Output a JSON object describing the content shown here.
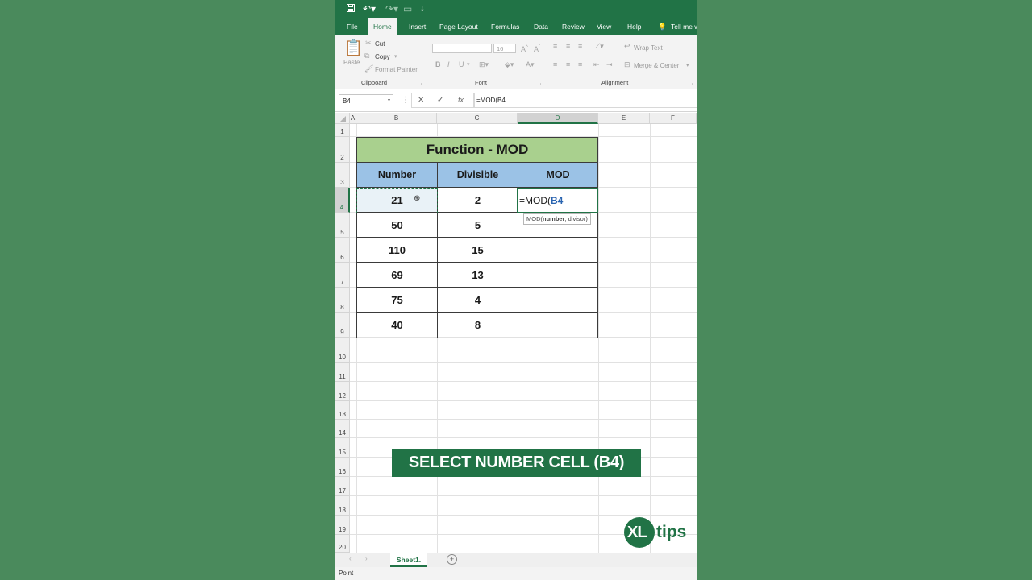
{
  "qat": {
    "save_icon": "save-icon",
    "undo_icon": "undo-icon",
    "redo_icon": "redo-icon",
    "customize_icon": "customize-icon"
  },
  "tabs": [
    "File",
    "Home",
    "Insert",
    "Page Layout",
    "Formulas",
    "Data",
    "Review",
    "View",
    "Help"
  ],
  "tell_me": "Tell me w",
  "ribbon": {
    "clipboard": {
      "paste": "Paste",
      "cut": "Cut",
      "copy": "Copy",
      "format_painter": "Format Painter",
      "label": "Clipboard"
    },
    "font": {
      "size": "16",
      "label": "Font"
    },
    "alignment": {
      "wrap_text": "Wrap Text",
      "merge_center": "Merge & Center",
      "label": "Alignment"
    }
  },
  "formula_bar": {
    "name_box": "B4",
    "formula": "=MOD(B4"
  },
  "columns": [
    "A",
    "B",
    "C",
    "D",
    "E",
    "F"
  ],
  "rows": [
    "1",
    "2",
    "3",
    "4",
    "5",
    "6",
    "7",
    "8",
    "9",
    "10",
    "11",
    "12",
    "13",
    "14",
    "15",
    "16",
    "17",
    "18",
    "19",
    "20"
  ],
  "table": {
    "title": "Function - MOD",
    "headers": [
      "Number",
      "Divisible",
      "MOD"
    ],
    "rows": [
      [
        "21",
        "2"
      ],
      [
        "50",
        "5"
      ],
      [
        "110",
        "15"
      ],
      [
        "69",
        "13"
      ],
      [
        "75",
        "4"
      ],
      [
        "40",
        "8"
      ]
    ]
  },
  "editing": {
    "prefix": "=MOD(",
    "ref": "B4",
    "tooltip_fn": "MOD(",
    "tooltip_arg1": "number",
    "tooltip_rest": ", divisor)"
  },
  "banner": "SELECT NUMBER CELL (B4)",
  "logo": {
    "xl": "XL",
    "tips": "tips"
  },
  "sheet_tab": "Sheet1.",
  "status": "Point",
  "colors": {
    "excel_green": "#217346",
    "title_fill": "#a9d08e",
    "header_fill": "#9bc2e6",
    "background": "#4a8a5c"
  }
}
